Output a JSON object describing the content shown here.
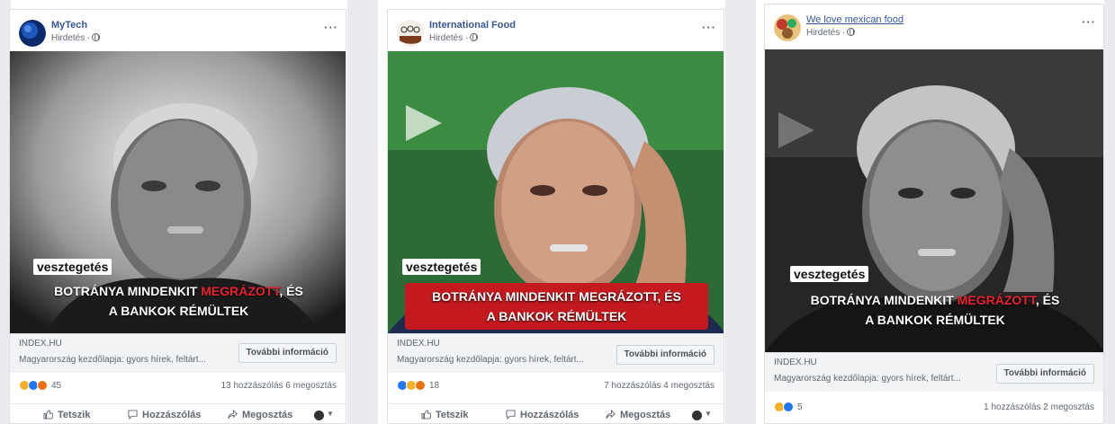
{
  "posts": [
    {
      "page_name": "MyTech",
      "sponsored": "Hirdetés ·",
      "tag": "vesztegetés",
      "headline_a": "BOTRÁNYA MINDENKIT ",
      "headline_red": "MEGRÁZOTT",
      "headline_b": ", ÉS",
      "headline_line2": "A BANKOK RÉMÜLTEK",
      "domain": "INDEX.HU",
      "description": "Magyarország kezdőlapja: gyors hírek, feltárt...",
      "cta": "További információ",
      "reaction_count": "45",
      "stats": "13 hozzászólás 6 megosztás",
      "like": "Tetszik",
      "comment": "Hozzászólás",
      "share": "Megosztás"
    },
    {
      "page_name": "International Food",
      "sponsored": "Hirdetés ·",
      "tag": "vesztegetés",
      "headline_a": "BOTRÁNYA MINDENKIT ",
      "headline_red": "MEGRÁZOTT",
      "headline_b": ", ÉS",
      "headline_line2": "A BANKOK RÉMÜLTEK",
      "domain": "INDEX.HU",
      "description": "Magyarország kezdőlapja: gyors hírek, feltárt...",
      "cta": "További információ",
      "reaction_count": "18",
      "stats": "7 hozzászólás 4 megosztás",
      "like": "Tetszik",
      "comment": "Hozzászólás",
      "share": "Megosztás"
    },
    {
      "page_name": "We love mexican food",
      "sponsored": "Hirdetés ·",
      "tag": "vesztegetés",
      "headline_a": "BOTRÁNYA MINDENKIT ",
      "headline_red": "MEGRÁZOTT",
      "headline_b": ", ÉS",
      "headline_line2": "A BANKOK RÉMÜLTEK",
      "domain": "INDEX.HU",
      "description": "Magyarország kezdőlapja: gyors hírek, feltárt...",
      "cta": "További információ",
      "reaction_count": "5",
      "stats": "1 hozzászólás 2 megosztás"
    }
  ],
  "colors": {
    "link": "#365899",
    "red_box": "#c41a1f",
    "headline_red": "#e8232e",
    "like_blue": "#2078f4"
  },
  "icons": [
    "more-options-icon",
    "globe-icon",
    "like-icon",
    "comment-icon",
    "share-icon",
    "haha-emoji-icon",
    "like-emoji-icon",
    "angry-emoji-icon"
  ]
}
